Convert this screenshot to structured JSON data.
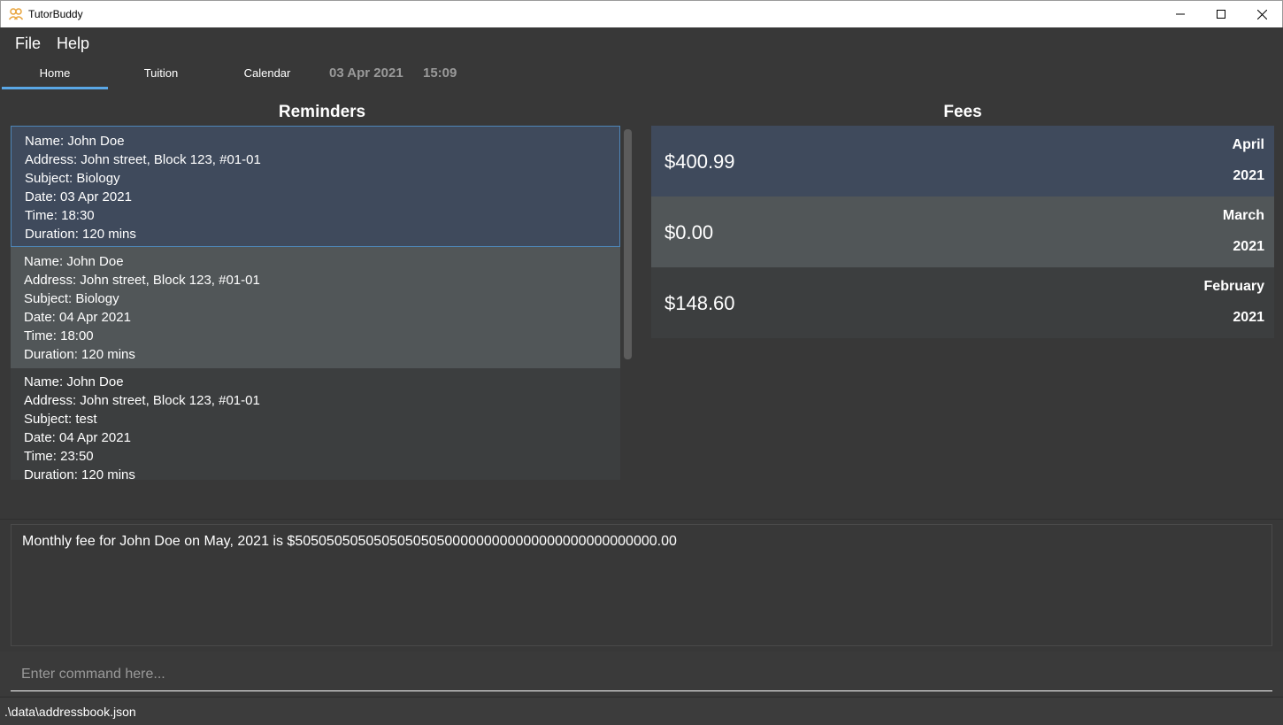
{
  "window": {
    "title": "TutorBuddy",
    "icon": "people-icon"
  },
  "menu": [
    "File",
    "Help"
  ],
  "tabs": [
    {
      "label": "Home",
      "active": true
    },
    {
      "label": "Tuition",
      "active": false
    },
    {
      "label": "Calendar",
      "active": false
    }
  ],
  "header": {
    "date": "03 Apr 2021",
    "time": "15:09"
  },
  "reminders": {
    "title": "Reminders",
    "items": [
      {
        "name": "Name: John Doe",
        "address": "Address: John street, Block 123, #01-01",
        "subject": "Subject: Biology",
        "date": "Date: 03 Apr 2021",
        "time": "Time: 18:30",
        "duration": "Duration: 120 mins"
      },
      {
        "name": "Name: John Doe",
        "address": "Address: John street, Block 123, #01-01",
        "subject": "Subject: Biology",
        "date": "Date: 04 Apr 2021",
        "time": "Time: 18:00",
        "duration": "Duration: 120 mins"
      },
      {
        "name": "Name: John Doe",
        "address": "Address: John street, Block 123, #01-01",
        "subject": "Subject: test",
        "date": "Date: 04 Apr 2021",
        "time": "Time: 23:50",
        "duration": "Duration: 120 mins"
      }
    ]
  },
  "fees": {
    "title": "Fees",
    "items": [
      {
        "amount": "$400.99",
        "month": "April",
        "year": "2021"
      },
      {
        "amount": "$0.00",
        "month": "March",
        "year": "2021"
      },
      {
        "amount": "$148.60",
        "month": "February",
        "year": "2021"
      }
    ]
  },
  "result": {
    "text": "Monthly fee for John Doe on May, 2021 is $5050505050505050505000000000000000000000000000.00"
  },
  "command": {
    "placeholder": "Enter command here..."
  },
  "status": {
    "path": ".\\data\\addressbook.json"
  },
  "colors": {
    "background": "#383838",
    "selected_card": "#3f4a5c",
    "alt_card": "#515658",
    "tab_indicator": "#5aa7e6"
  }
}
